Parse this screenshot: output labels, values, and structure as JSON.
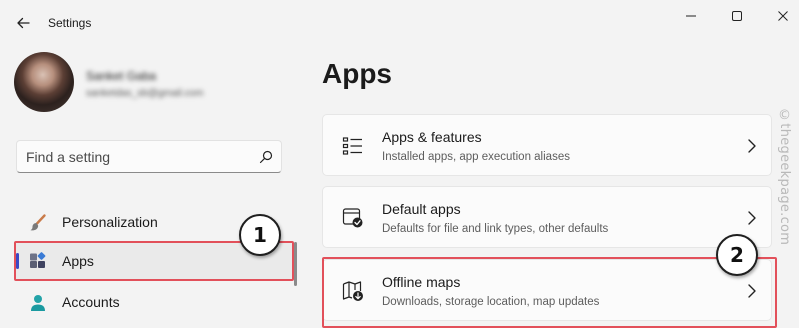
{
  "window": {
    "title": "Settings",
    "controls": {
      "minimize": "minimize-icon",
      "maximize": "maximize-icon",
      "close": "close-icon"
    }
  },
  "user": {
    "name": "Sanket Gaba",
    "email": "sanketdas_sb@gmail.com"
  },
  "search": {
    "value": "",
    "placeholder": "Find a setting"
  },
  "sidebar": {
    "items": [
      {
        "label": "Personalization",
        "icon": "paintbrush-icon",
        "selected": false
      },
      {
        "label": "Apps",
        "icon": "apps-icon",
        "selected": true
      },
      {
        "label": "Accounts",
        "icon": "person-icon",
        "selected": false
      }
    ]
  },
  "main": {
    "title": "Apps",
    "cards": [
      {
        "title": "Apps & features",
        "subtitle": "Installed apps, app execution aliases",
        "icon": "list-icon"
      },
      {
        "title": "Default apps",
        "subtitle": "Defaults for file and link types, other defaults",
        "icon": "default-apps-icon"
      },
      {
        "title": "Offline maps",
        "subtitle": "Downloads, storage location, map updates",
        "icon": "map-icon"
      }
    ]
  },
  "annotations": {
    "marker_1": "1",
    "marker_2": "2",
    "highlight_color": "#e2505a"
  },
  "watermark": "©thegeekpage.com",
  "colors": {
    "accent": "#3b49c4",
    "background": "#f3f3f3",
    "card": "#fbfbfb"
  }
}
